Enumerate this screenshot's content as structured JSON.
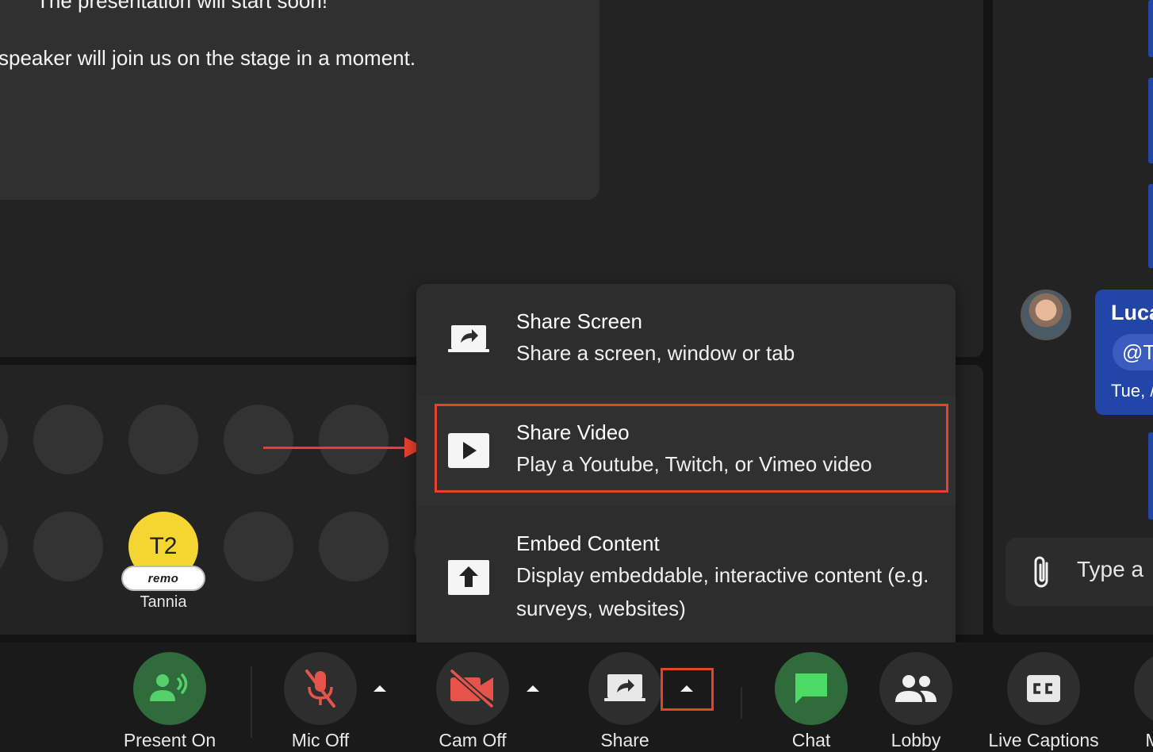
{
  "stage": {
    "line1": "The presentation will start soon!",
    "line2": "speaker will join us on the stage in a moment."
  },
  "audience": {
    "occupant": {
      "initials": "T2",
      "badge": "remo",
      "name": "Tannia",
      "avatar_color": "#f5d532"
    }
  },
  "share_menu": {
    "items": [
      {
        "title": "Share Screen",
        "description": "Share a screen, window or tab",
        "icon": "share-screen-icon"
      },
      {
        "title": "Share Video",
        "description": "Play a Youtube, Twitch, or Vimeo video",
        "icon": "play-video-icon"
      },
      {
        "title": "Embed Content",
        "description": "Display embeddable, interactive content (e.g. surveys, websites)",
        "icon": "upload-embed-icon"
      }
    ]
  },
  "chat": {
    "message": {
      "author": "Luca",
      "mention": "@Ta",
      "time": "Tue, /"
    },
    "input_placeholder": "Type a"
  },
  "toolbar": {
    "present_label": "Present On",
    "mic_label": "Mic Off",
    "cam_label": "Cam Off",
    "share_label": "Share",
    "chat_label": "Chat",
    "lobby_label": "Lobby",
    "captions_label": "Live Captions",
    "more_label": "M"
  },
  "colors": {
    "accent_red": "#e8402a",
    "present_green": "#55d06b",
    "mic_red": "#e5534b",
    "chat_green": "#4cd964",
    "chat_bubble": "#2245a8"
  }
}
